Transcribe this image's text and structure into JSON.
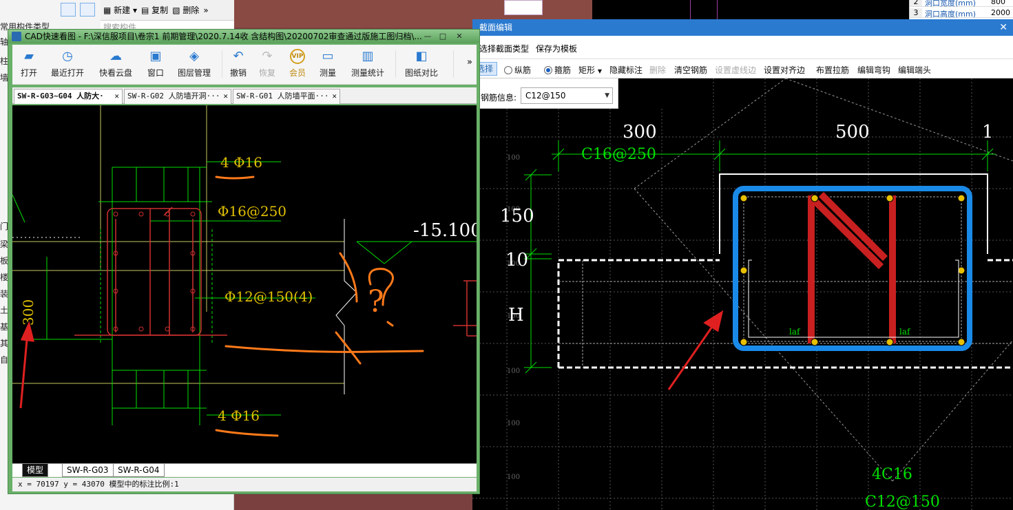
{
  "background": {
    "left_panel": {
      "toolbar": [
        "新建",
        "复制",
        "删除"
      ],
      "search_placeholder": "搜索构件",
      "tree_header": "常用构件类型",
      "side_chars": [
        "轴",
        "柱",
        "墙",
        "门",
        "梁",
        "板",
        "楼",
        "装",
        "土",
        "基",
        "其",
        "自"
      ]
    },
    "table": {
      "rows": [
        {
          "num": "2",
          "name": "洞口宽度(mm)",
          "value": "800"
        },
        {
          "num": "3",
          "name": "洞口高度(mm)",
          "value": "2000"
        }
      ]
    }
  },
  "cad_viewer": {
    "title": "CAD快速看图 - F:\\深信服项目\\卷宗1 前期管理\\2020.7.14收 含结构图\\20200702审查通过版施工图归档\\...",
    "window_buttons": [
      "—",
      "□",
      "✕"
    ],
    "toolbar": [
      {
        "label": "打开",
        "icon": "folder-icon",
        "glyph": "▰"
      },
      {
        "label": "最近打开",
        "icon": "clock-icon",
        "glyph": "◷"
      },
      {
        "label": "快看云盘",
        "icon": "cloud-icon",
        "glyph": "☁"
      },
      {
        "label": "窗口",
        "icon": "window-icon",
        "glyph": "▣"
      },
      {
        "label": "图层管理",
        "icon": "layers-icon",
        "glyph": "◈"
      },
      {
        "label": "撤销",
        "icon": "undo-icon",
        "glyph": "↶"
      },
      {
        "label": "恢复",
        "icon": "redo-icon",
        "glyph": "↷"
      },
      {
        "label": "会员",
        "icon": "vip-icon",
        "glyph": "VIP"
      },
      {
        "label": "测量",
        "icon": "ruler-icon",
        "glyph": "▭"
      },
      {
        "label": "测量统计",
        "icon": "chart-icon",
        "glyph": "▥"
      },
      {
        "label": "图纸对比",
        "icon": "compare-icon",
        "glyph": "◧"
      }
    ],
    "more": "»",
    "tabs": [
      {
        "label": "SW-R-G03~G04 人防大·",
        "active": true
      },
      {
        "label": "SW-R-G02 人防墙开洞···",
        "active": false
      },
      {
        "label": "SW-R-G01 人防墙平面···",
        "active": false
      }
    ],
    "drawing": {
      "labels": [
        "4 Φ16",
        "Φ16@250",
        "-15.100",
        "Φ12@150(4)",
        "300",
        "4 Φ16",
        "?"
      ]
    },
    "bottom_tabs": [
      "模型",
      "SW-R-G03",
      "SW-R-G04"
    ],
    "status": "x = 70197  y = 43070    模型中的标注比例:1"
  },
  "section_editor": {
    "title": "截面编辑",
    "menu": [
      "选择截面类型",
      "保存为模板"
    ],
    "toolbar": {
      "select": "选择",
      "longitudinal": "纵筋",
      "stirrup": "箍筋",
      "shape": "矩形",
      "hide_dims": "隐藏标注",
      "delete": "删除",
      "clear_rebar": "清空钢筋",
      "set_dashed_edge": "设置虚线边",
      "set_align_edge": "设置对齐边",
      "place_tie": "布置拉筋",
      "edit_hook": "编辑弯钩",
      "edit_end": "编辑端头"
    },
    "rebar_info_label": "钢筋信息:",
    "rebar_info_value": "C12@150",
    "drawing": {
      "dims": [
        "300",
        "500",
        "1",
        "150",
        "10",
        "H"
      ],
      "labels": [
        "C16@250",
        "laf",
        "laf",
        "4C16",
        "C12@150"
      ],
      "grid_label": "100"
    }
  },
  "colors": {
    "title_blue": "#2a7ad0",
    "cad_green": "#00ff00",
    "cad_yellow": "#e0c000",
    "annotation_orange": "#ff7a1a",
    "stirrup_blue": "#1a8ae8",
    "rebar_red": "#c82020",
    "arrow_red": "#e02020"
  }
}
